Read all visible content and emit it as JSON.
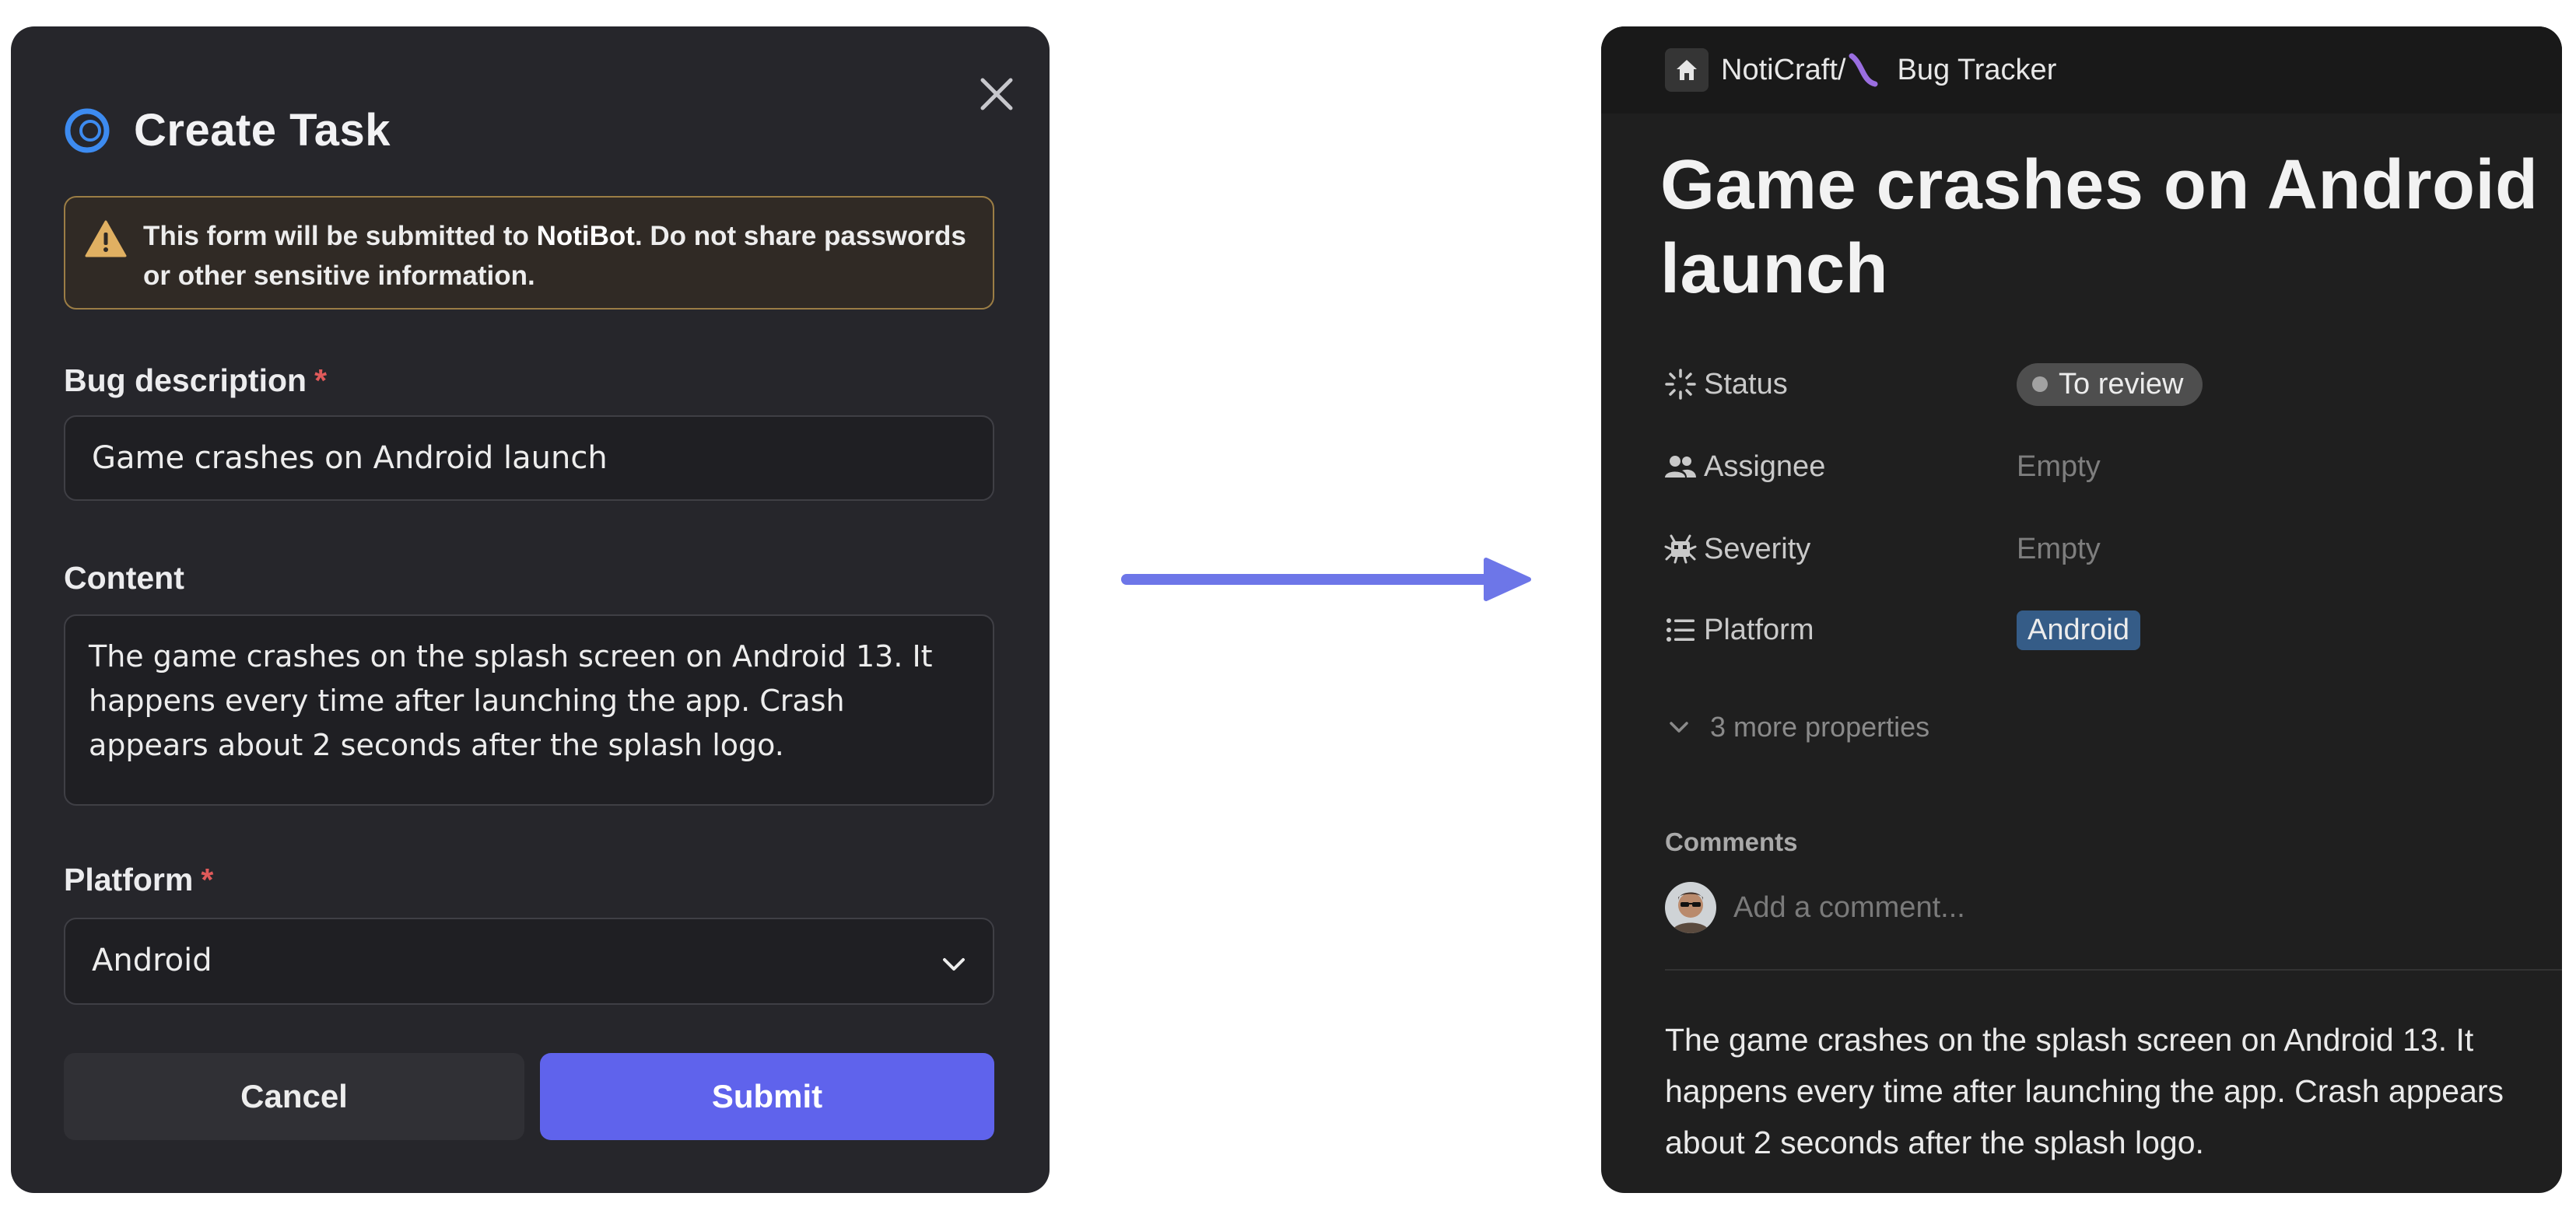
{
  "modal": {
    "title": "Create Task",
    "warning": {
      "prefix": "This form will be submitted to ",
      "bot_name": "NotiBot",
      "suffix": ". Do not share passwords or other sensitive information."
    },
    "bug_description": {
      "label": "Bug description",
      "required_mark": "*",
      "value": "Game crashes on Android launch"
    },
    "content": {
      "label": "Content",
      "value": "The game crashes on the splash screen on Android 13. It happens every time after launching the app. Crash appears about 2 seconds after the splash logo."
    },
    "platform": {
      "label": "Platform",
      "required_mark": "*",
      "selected": "Android"
    },
    "cancel_label": "Cancel",
    "submit_label": "Submit"
  },
  "page": {
    "breadcrumb": {
      "workspace": "NotiCraft",
      "separator": "/",
      "database": "Bug Tracker"
    },
    "title": "Game crashes on Android launch",
    "properties": {
      "status": {
        "name": "Status",
        "value": "To review"
      },
      "assignee": {
        "name": "Assignee",
        "value": "Empty"
      },
      "severity": {
        "name": "Severity",
        "value": "Empty"
      },
      "platform": {
        "name": "Platform",
        "value": "Android"
      }
    },
    "more_properties": "3 more properties",
    "comments_heading": "Comments",
    "comment_placeholder": "Add a comment...",
    "body": "The game crashes on the splash screen on Android 13. It happens every time after launching the app. Crash appears about 2 seconds after the splash logo."
  },
  "colors": {
    "accent": "#5f63ec",
    "required": "#e05a5a",
    "warning_border": "#9b7d45",
    "arrow": "#6d76e8",
    "android_tag": "#355c87"
  },
  "icons": [
    "notion-logo-icon",
    "close-icon",
    "warning-icon",
    "chevron-down-icon",
    "arrow-right-icon",
    "home-icon",
    "bug-tracker-icon",
    "status-icon",
    "people-icon",
    "bug-icon",
    "list-icon",
    "avatar"
  ]
}
